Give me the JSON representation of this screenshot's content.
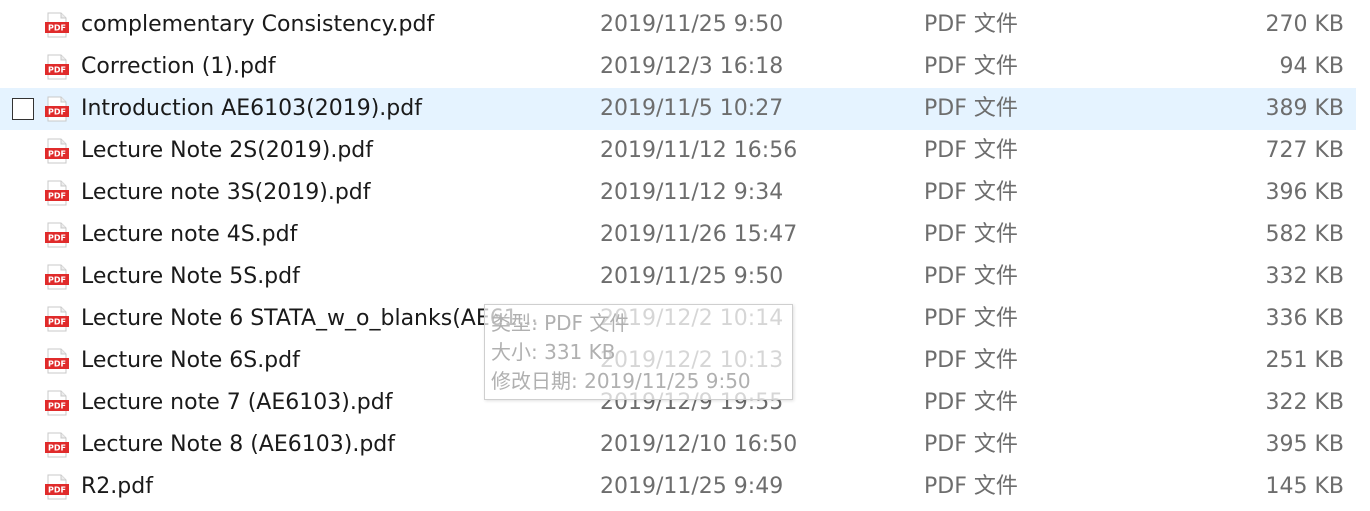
{
  "files": [
    {
      "name": "complementary Consistency.pdf",
      "date": "2019/11/25 9:50",
      "type": "PDF 文件",
      "size": "270 KB",
      "icon": "pdf-file-icon"
    },
    {
      "name": "Correction (1).pdf",
      "date": "2019/12/3 16:18",
      "type": "PDF 文件",
      "size": "94 KB",
      "icon": "pdf-file-icon"
    },
    {
      "name": "Introduction AE6103(2019).pdf",
      "date": "2019/11/5 10:27",
      "type": "PDF 文件",
      "size": "389 KB",
      "icon": "pdf-file-icon",
      "selected": true
    },
    {
      "name": "Lecture Note 2S(2019).pdf",
      "date": "2019/11/12 16:56",
      "type": "PDF 文件",
      "size": "727 KB",
      "icon": "pdf-file-icon"
    },
    {
      "name": "Lecture note 3S(2019).pdf",
      "date": "2019/11/12 9:34",
      "type": "PDF 文件",
      "size": "396 KB",
      "icon": "pdf-file-icon"
    },
    {
      "name": "Lecture note 4S.pdf",
      "date": "2019/11/26 15:47",
      "type": "PDF 文件",
      "size": "582 KB",
      "icon": "pdf-file-icon"
    },
    {
      "name": "Lecture Note 5S.pdf",
      "date": "2019/11/25 9:50",
      "type": "PDF 文件",
      "size": "332 KB",
      "icon": "pdf-file-icon"
    },
    {
      "name": "Lecture Note 6 STATA_w_o_blanks(AE61...",
      "date": "2019/12/2 10:14",
      "type": "PDF 文件",
      "size": "336 KB",
      "icon": "pdf-file-icon"
    },
    {
      "name": "Lecture Note 6S.pdf",
      "date": "2019/12/2 10:13",
      "type": "PDF 文件",
      "size": "251 KB",
      "icon": "pdf-file-icon"
    },
    {
      "name": "Lecture note 7 (AE6103).pdf",
      "date": "2019/12/9 19:55",
      "type": "PDF 文件",
      "size": "322 KB",
      "icon": "pdf-file-icon"
    },
    {
      "name": "Lecture Note 8 (AE6103).pdf",
      "date": "2019/12/10 16:50",
      "type": "PDF 文件",
      "size": "395 KB",
      "icon": "pdf-file-icon"
    },
    {
      "name": "R2.pdf",
      "date": "2019/11/25 9:49",
      "type": "PDF 文件",
      "size": "145 KB",
      "icon": "pdf-file-icon"
    }
  ],
  "tooltip": {
    "type_line": "类型: PDF 文件",
    "size_line": "大小: 331 KB",
    "modified_line": "修改日期: 2019/11/25 9:50"
  },
  "colors": {
    "selected_row": "#e5f3ff",
    "pdf_icon_red": "#e02b2b",
    "secondary_text": "#6d6d6d"
  }
}
